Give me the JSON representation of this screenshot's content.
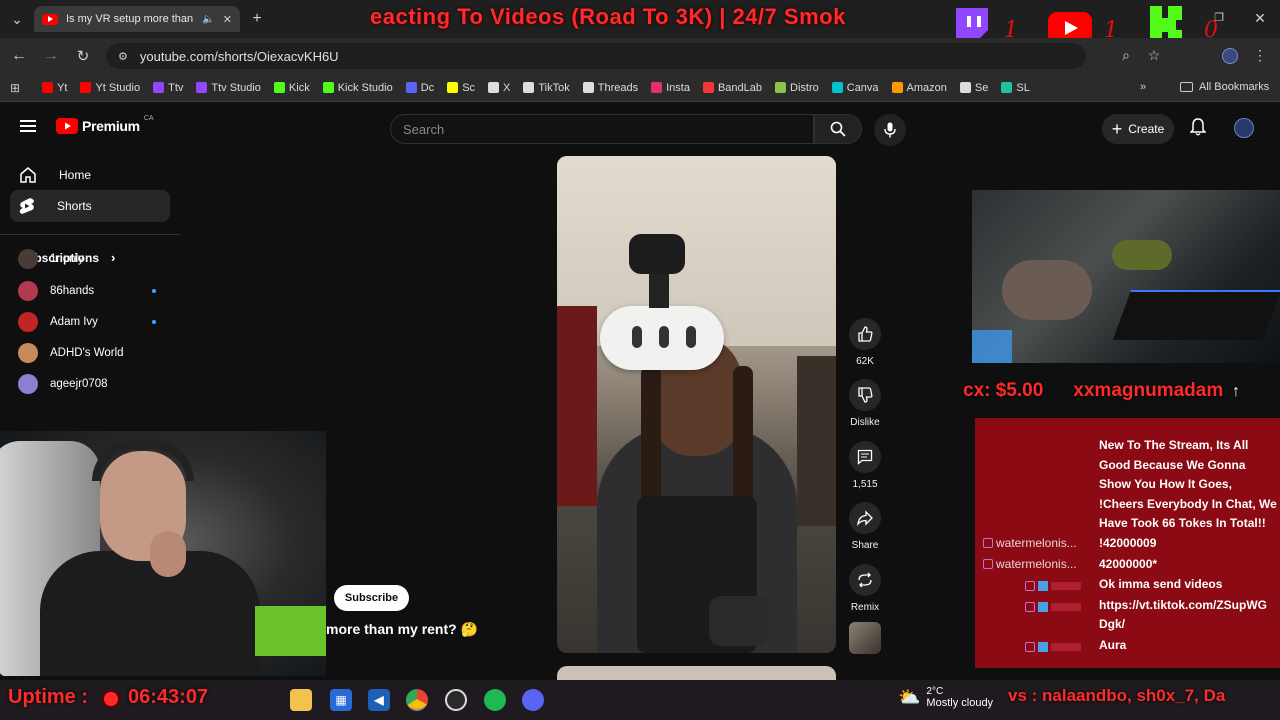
{
  "browser": {
    "tab_title": "Is my VR setup more than m",
    "url": "youtube.com/shorts/OiexacvKH6U",
    "bookmarks": [
      {
        "label": "Yt",
        "color": "#ff0000"
      },
      {
        "label": "Yt Studio",
        "color": "#ff0000"
      },
      {
        "label": "Ttv",
        "color": "#9146ff"
      },
      {
        "label": "Ttv Studio",
        "color": "#9146ff"
      },
      {
        "label": "Kick",
        "color": "#53fc18"
      },
      {
        "label": "Kick Studio",
        "color": "#53fc18"
      },
      {
        "label": "Dc",
        "color": "#5865f2"
      },
      {
        "label": "Sc",
        "color": "#fffc00"
      },
      {
        "label": "X",
        "color": "#dddddd"
      },
      {
        "label": "TikTok",
        "color": "#dddddd"
      },
      {
        "label": "Threads",
        "color": "#dddddd"
      },
      {
        "label": "Insta",
        "color": "#e1306c"
      },
      {
        "label": "BandLab",
        "color": "#f2373b"
      },
      {
        "label": "Distro",
        "color": "#8bc34a"
      },
      {
        "label": "Canva",
        "color": "#00c4cc"
      },
      {
        "label": "Amazon",
        "color": "#ff9900"
      },
      {
        "label": "Se",
        "color": "#dddddd"
      },
      {
        "label": "SL",
        "color": "#20c0a0"
      }
    ],
    "all_bookmarks": "All Bookmarks"
  },
  "stream_overlay": {
    "title_ticker": "eacting To Videos (Road To 3K) | 24/7 Smok",
    "twitch_count": "1",
    "youtube_count": "1",
    "kick_count": "0",
    "donation_left": "cx: $5.00",
    "donation_right": "xxmagnumadam",
    "uptime_label": "Uptime :",
    "uptime_value": "06:43:07",
    "followers_ticker": "vs : nalaandbo, sh0x_7, Da"
  },
  "youtube": {
    "logo": "Premium",
    "logo_region": "CA",
    "search_placeholder": "Search",
    "create_label": "Create",
    "sidebar": {
      "home": "Home",
      "shorts": "Shorts",
      "subscriptions": "Subscriptions",
      "channels": [
        {
          "name": "1nonly",
          "color": "#4a3b36",
          "dot": false
        },
        {
          "name": "86hands",
          "color": "#b33a4e",
          "dot": true
        },
        {
          "name": "Adam Ivy",
          "color": "#c12424",
          "dot": true
        },
        {
          "name": "ADHD's World",
          "color": "#c88a5a",
          "dot": false
        },
        {
          "name": "ageejr0708",
          "color": "#8a7fd0",
          "dot": false
        }
      ]
    },
    "short": {
      "likes": "62K",
      "dislike_label": "Dislike",
      "comments": "1,515",
      "share_label": "Share",
      "remix_label": "Remix",
      "subscribe_label": "Subscribe",
      "caption": "more than my rent? 🤔"
    }
  },
  "chat": {
    "alert": "New To The Stream, Its All Good Because We Gonna Show You How It Goes, !Cheers Everybody In Chat, We Have Took 66 Tokes In Total!!",
    "messages": [
      {
        "user": "watermelonis...",
        "text": "!42000009"
      },
      {
        "user": "watermelonis...",
        "text": "42000000*"
      },
      {
        "user": "",
        "text": "Ok imma send videos"
      },
      {
        "user": "",
        "text": "https://vt.tiktok.com/ZSupWG"
      },
      {
        "user": "",
        "text": "Dgk/"
      },
      {
        "user": "",
        "text": "Aura"
      }
    ]
  },
  "taskbar": {
    "temperature": "2°C",
    "weather": "Mostly cloudy"
  }
}
